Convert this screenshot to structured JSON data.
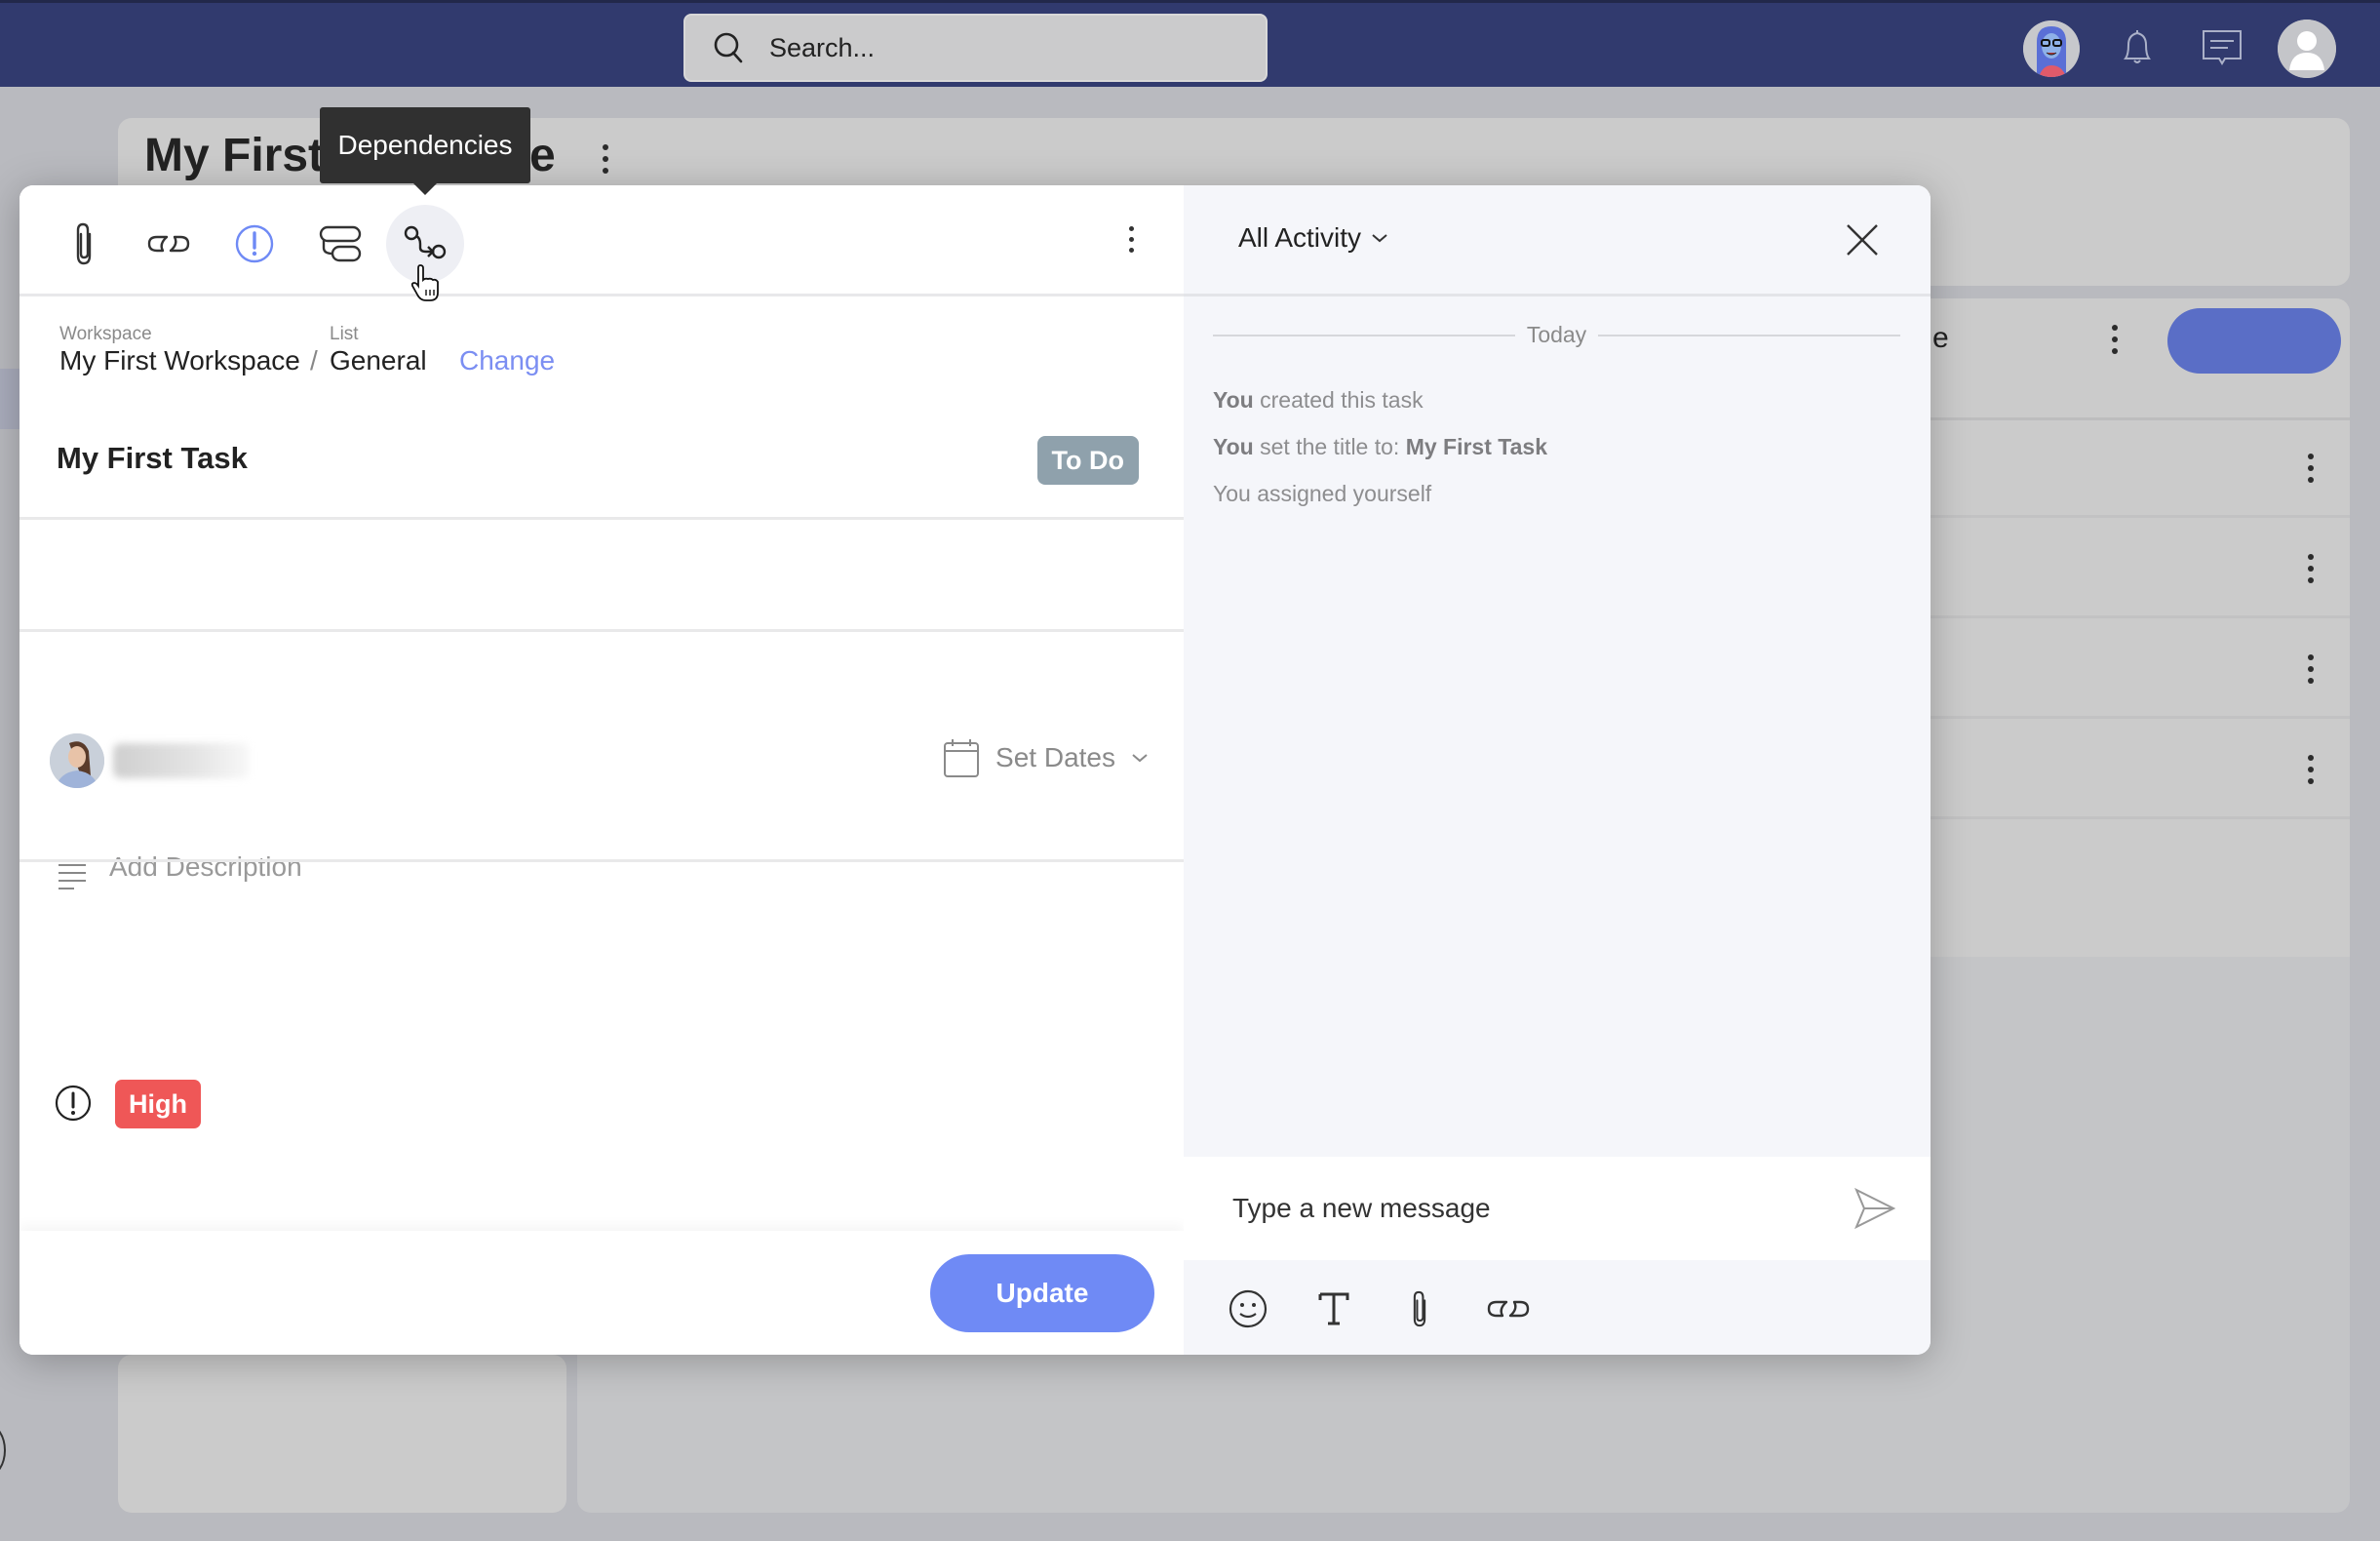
{
  "topbar": {
    "search_placeholder": "Search...",
    "icons": [
      "user-avatar-illustration",
      "bell-icon",
      "chat-icon",
      "profile-avatar-icon"
    ]
  },
  "background": {
    "page_title_visible_start": "My First",
    "page_title_visible_end": "e",
    "list_header_partial": "e"
  },
  "tooltip": {
    "text": "Dependencies"
  },
  "task_modal": {
    "toolbar": {
      "buttons": [
        "attachment",
        "link",
        "priority",
        "subtasks",
        "dependencies"
      ],
      "active_hover": "dependencies"
    },
    "breadcrumb": {
      "workspace_label": "Workspace",
      "workspace_value": "My First Workspace",
      "separator": "/",
      "list_label": "List",
      "list_value": "General",
      "change_link": "Change"
    },
    "title": "My First Task",
    "status": "To Do",
    "status_color": "#8fa1ac",
    "assignee": {
      "name_blurred": true
    },
    "dates_label": "Set Dates",
    "description_placeholder": "Add Description",
    "priority": {
      "label": "High",
      "color": "#ef5757"
    },
    "update_button": "Update",
    "accent_color": "#6f8af5"
  },
  "activity": {
    "filter_label": "All Activity",
    "date_group": "Today",
    "entries": [
      {
        "actor": "You",
        "text": " created this task",
        "bold_suffix": ""
      },
      {
        "actor": "You",
        "text": " set the title to: ",
        "bold_suffix": "My First Task"
      },
      {
        "actor": "",
        "text": "You assigned yourself",
        "bold_suffix": ""
      }
    ],
    "message_placeholder": "Type a new message",
    "composer_tools": [
      "emoji",
      "text-format",
      "attachment",
      "link"
    ]
  }
}
